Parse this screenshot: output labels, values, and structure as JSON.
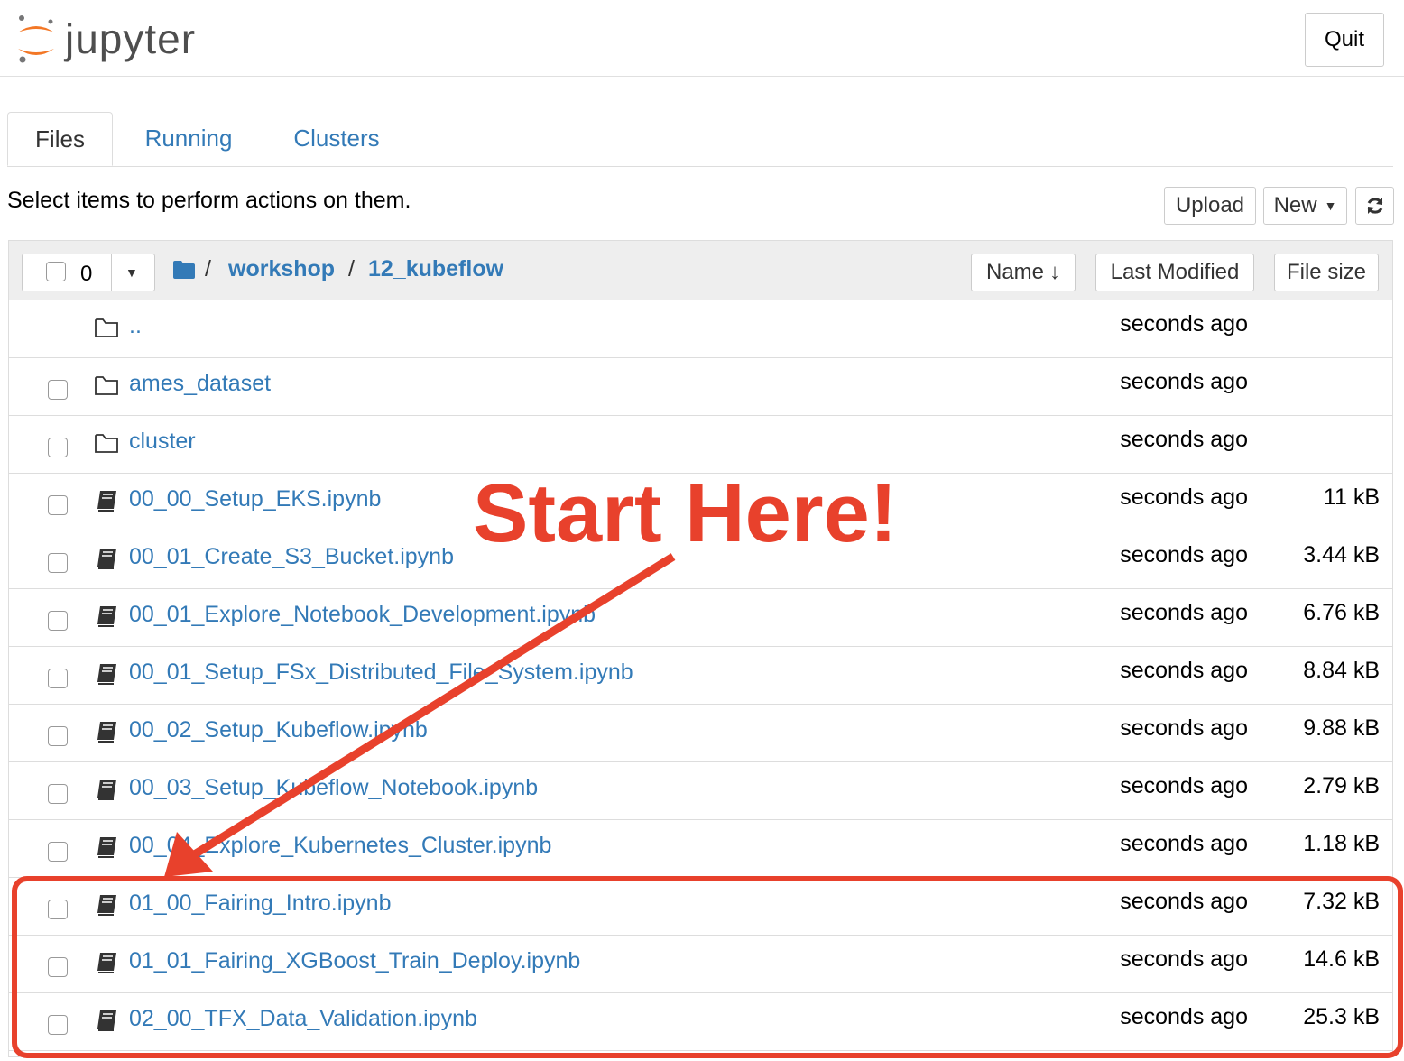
{
  "app": {
    "logo_text": "jupyter",
    "quit_label": "Quit"
  },
  "tabs": [
    {
      "label": "Files"
    },
    {
      "label": "Running"
    },
    {
      "label": "Clusters"
    }
  ],
  "toolbar": {
    "hint": "Select items to perform actions on them.",
    "upload_label": "Upload",
    "new_label": "New",
    "refresh_icon": "refresh-icon"
  },
  "list_header": {
    "selected_count": "0",
    "breadcrumb": [
      "workshop",
      "12_kubeflow"
    ],
    "sort_name": "Name",
    "sort_modified": "Last Modified",
    "sort_size": "File size"
  },
  "files": [
    {
      "name": "..",
      "type": "folder",
      "modified": "seconds ago",
      "size": ""
    },
    {
      "name": "ames_dataset",
      "type": "folder",
      "modified": "seconds ago",
      "size": ""
    },
    {
      "name": "cluster",
      "type": "folder",
      "modified": "seconds ago",
      "size": ""
    },
    {
      "name": "00_00_Setup_EKS.ipynb",
      "type": "notebook",
      "modified": "seconds ago",
      "size": "11 kB"
    },
    {
      "name": "00_01_Create_S3_Bucket.ipynb",
      "type": "notebook",
      "modified": "seconds ago",
      "size": "3.44 kB"
    },
    {
      "name": "00_01_Explore_Notebook_Development.ipynb",
      "type": "notebook",
      "modified": "seconds ago",
      "size": "6.76 kB"
    },
    {
      "name": "00_01_Setup_FSx_Distributed_File_System.ipynb",
      "type": "notebook",
      "modified": "seconds ago",
      "size": "8.84 kB"
    },
    {
      "name": "00_02_Setup_Kubeflow.ipynb",
      "type": "notebook",
      "modified": "seconds ago",
      "size": "9.88 kB"
    },
    {
      "name": "00_03_Setup_Kubeflow_Notebook.ipynb",
      "type": "notebook",
      "modified": "seconds ago",
      "size": "2.79 kB"
    },
    {
      "name": "00_04_Explore_Kubernetes_Cluster.ipynb",
      "type": "notebook",
      "modified": "seconds ago",
      "size": "1.18 kB"
    },
    {
      "name": "01_00_Fairing_Intro.ipynb",
      "type": "notebook",
      "modified": "seconds ago",
      "size": "7.32 kB"
    },
    {
      "name": "01_01_Fairing_XGBoost_Train_Deploy.ipynb",
      "type": "notebook",
      "modified": "seconds ago",
      "size": "14.6 kB"
    },
    {
      "name": "02_00_TFX_Data_Validation.ipynb",
      "type": "notebook",
      "modified": "seconds ago",
      "size": "25.3 kB"
    }
  ],
  "annotation": {
    "text": "Start Here!",
    "color": "#e8412c"
  },
  "colors": {
    "link": "#337ab7",
    "accent_orange": "#f37726"
  }
}
